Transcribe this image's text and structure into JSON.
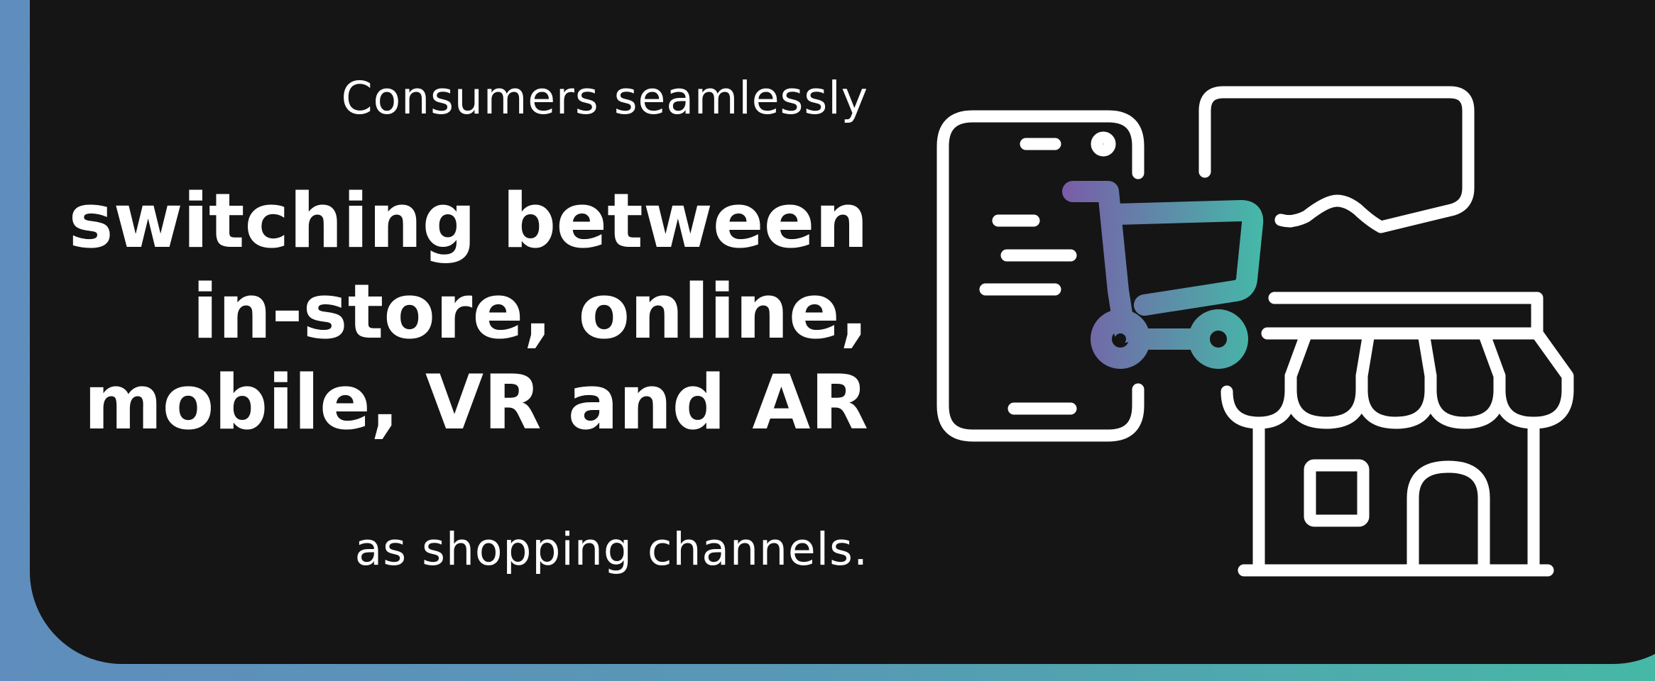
{
  "text": {
    "lead": "Consumers seamlessly",
    "headline": [
      "switching between",
      "in-store, online,",
      "mobile, VR and AR"
    ],
    "tail": "as shopping channels."
  },
  "icons": [
    "smartphone-icon",
    "shopping-cart-icon",
    "speech-bubble-icon",
    "storefront-icon"
  ],
  "colors": {
    "background_gradient_start": "#5f8dbd",
    "background_gradient_end": "#46b8a6",
    "card": "#151515",
    "text": "#ffffff",
    "cart_gradient_start": "#7a5aa8",
    "cart_gradient_end": "#45b8a8"
  }
}
